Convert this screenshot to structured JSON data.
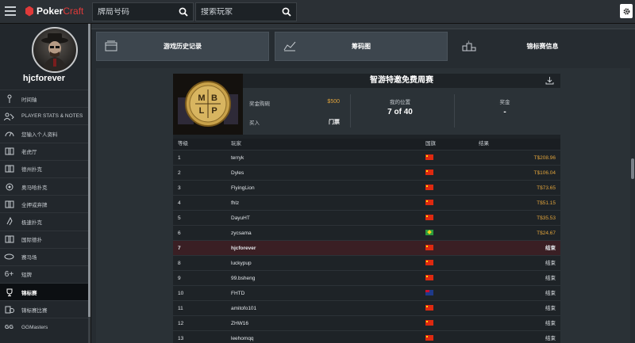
{
  "app": {
    "logo_main": "Poker",
    "logo_accent": "Craft"
  },
  "search": {
    "hand_placeholder": "牌局号码",
    "player_placeholder": "搜索玩家"
  },
  "sidebar": {
    "username": "hjcforever",
    "items": [
      {
        "label": "时间轴",
        "icon": "timeline-icon"
      },
      {
        "label": "PLAYER STATS & NOTES",
        "icon": "player-stats-icon"
      },
      {
        "label": "您输入个人资料",
        "icon": "speedometer-icon"
      },
      {
        "label": "老虎厅",
        "icon": "cards-icon"
      },
      {
        "label": "德州扑克",
        "icon": "holdem-icon"
      },
      {
        "label": "奥马哈扑克",
        "icon": "omaha-icon"
      },
      {
        "label": "全押或弃牌",
        "icon": "allin-icon"
      },
      {
        "label": "极速扑克",
        "icon": "rush-icon"
      },
      {
        "label": "国际德扑",
        "icon": "intl-cards-icon"
      },
      {
        "label": "赛马场",
        "icon": "racetrack-icon"
      },
      {
        "label": "短牌",
        "icon": "six-plus-icon"
      },
      {
        "label": "锦标赛",
        "icon": "trophy-icon",
        "active": true
      },
      {
        "label": "锦标赛比赛",
        "icon": "tournament-game-icon"
      },
      {
        "label": "GGMasters",
        "icon": "gg-icon"
      }
    ]
  },
  "tabs": [
    {
      "label": "游戏历史记录",
      "icon": "history-icon"
    },
    {
      "label": "筹码图",
      "icon": "chart-icon"
    },
    {
      "label": "锦标赛信息",
      "icon": "podium-icon",
      "selected": true
    }
  ],
  "tournament": {
    "title": "智游特邀免费周赛",
    "logo_letters": [
      "M",
      "B",
      "L",
      "P"
    ],
    "buyin_label": "奖金购碗",
    "buyin_value": "$500",
    "entry_label": "买入",
    "entry_value": "门票",
    "position_label": "我的位置",
    "position_value": "7 of 40",
    "prize_label": "奖金",
    "prize_value": "-",
    "columns": {
      "rank": "等级",
      "player": "玩家",
      "country": "国旗",
      "result": "结果"
    },
    "rows": [
      {
        "rank": "1",
        "player": "terryk",
        "flag": "cn",
        "result": "T$208.96"
      },
      {
        "rank": "2",
        "player": "Dyles",
        "flag": "cn",
        "result": "T$106.04"
      },
      {
        "rank": "3",
        "player": "FlyingLion",
        "flag": "cn",
        "result": "T$73.65"
      },
      {
        "rank": "4",
        "player": "fhlz",
        "flag": "cn",
        "result": "T$51.15"
      },
      {
        "rank": "5",
        "player": "DayuHT",
        "flag": "cn",
        "result": "T$35.53"
      },
      {
        "rank": "6",
        "player": "zycsama",
        "flag": "br",
        "result": "T$24.67"
      },
      {
        "rank": "7",
        "player": "hjcforever",
        "flag": "cn",
        "result": "结束",
        "me": true
      },
      {
        "rank": "8",
        "player": "luckypup",
        "flag": "cn",
        "result": "结束"
      },
      {
        "rank": "9",
        "player": "99.bsheng",
        "flag": "cn",
        "result": "结束"
      },
      {
        "rank": "10",
        "player": "FHTD",
        "flag": "au",
        "result": "结束"
      },
      {
        "rank": "11",
        "player": "amitofo101",
        "flag": "cn",
        "result": "结束"
      },
      {
        "rank": "12",
        "player": "ZHW16",
        "flag": "cn",
        "result": "结束"
      },
      {
        "rank": "13",
        "player": "leehomqq",
        "flag": "cn",
        "result": "结束"
      }
    ]
  },
  "colors": {
    "accent_red": "#e03a3a",
    "prize_gold": "#e0a33b",
    "highlight_row": "#3a1f24"
  }
}
